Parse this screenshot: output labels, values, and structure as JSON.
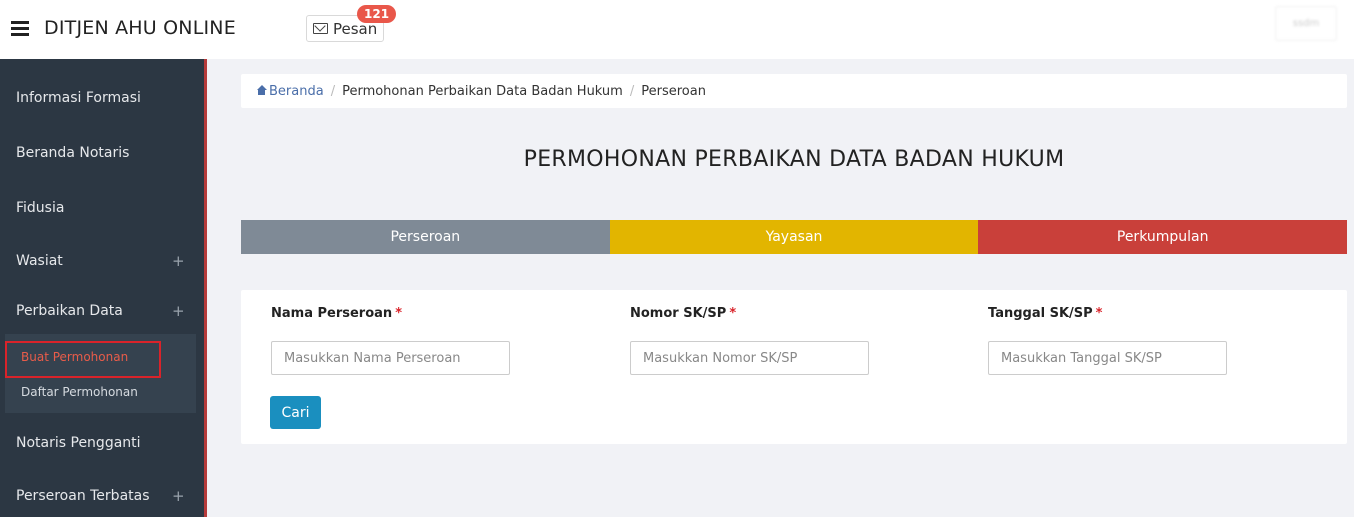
{
  "header": {
    "brand": "DITJEN AHU ONLINE",
    "pesan_label": "Pesan",
    "pesan_badge": "121",
    "user_label": "ssdm"
  },
  "sidebar": {
    "items": [
      {
        "label": "Informasi Formasi",
        "expandable": false
      },
      {
        "label": "Beranda Notaris",
        "expandable": false
      },
      {
        "label": "Fidusia",
        "expandable": false
      },
      {
        "label": "Wasiat",
        "expandable": true
      },
      {
        "label": "Perbaikan Data",
        "expandable": true
      },
      {
        "label": "Notaris Pengganti",
        "expandable": false
      },
      {
        "label": "Perseroan Terbatas",
        "expandable": true
      }
    ],
    "plus": "+",
    "subitems": [
      {
        "label": "Buat Permohonan",
        "active": true
      },
      {
        "label": "Daftar Permohonan",
        "active": false
      }
    ]
  },
  "breadcrumb": {
    "home": "Beranda",
    "separator": "/",
    "items": [
      "Permohonan Perbaikan Data Badan Hukum",
      "Perseroan"
    ]
  },
  "page_title": "PERMOHONAN PERBAIKAN DATA BADAN HUKUM",
  "tabs": [
    {
      "label": "Perseroan",
      "color": "#7f8a96"
    },
    {
      "label": "Yayasan",
      "color": "#e2b500"
    },
    {
      "label": "Perkumpulan",
      "color": "#c9403a"
    }
  ],
  "form": {
    "required_mark": "*",
    "fields": [
      {
        "label": "Nama Perseroan",
        "placeholder": "Masukkan Nama Perseroan",
        "value": ""
      },
      {
        "label": "Nomor SK/SP",
        "placeholder": "Masukkan Nomor SK/SP",
        "value": ""
      },
      {
        "label": "Tanggal SK/SP",
        "placeholder": "Masukkan Tanggal SK/SP",
        "value": ""
      }
    ],
    "submit_label": "Cari"
  },
  "colors": {
    "sidebar_bg": "#2c3743",
    "active_subitem_text": "#e85c4a",
    "highlight_border": "#d9232a",
    "button_primary": "#1a8fbf",
    "badge": "#e9574a"
  },
  "icons": {
    "menu": "hamburger-icon",
    "mail": "envelope-icon",
    "home": "home-icon",
    "expand": "plus-icon"
  }
}
